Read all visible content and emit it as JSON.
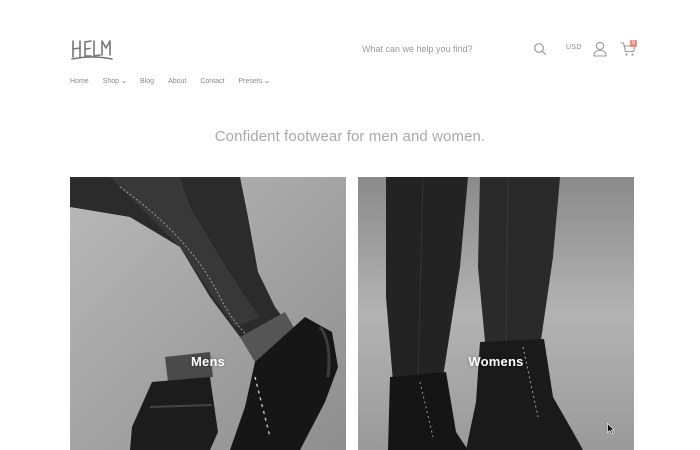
{
  "header": {
    "logo_text": "HELM",
    "search": {
      "placeholder": "What can we help you find?"
    },
    "currency": "USD",
    "cart_count": "0"
  },
  "nav": {
    "items": [
      {
        "label": "Home"
      },
      {
        "label": "Shop",
        "has_dropdown": true
      },
      {
        "label": "Blog"
      },
      {
        "label": "About"
      },
      {
        "label": "Contact"
      },
      {
        "label": "Presets",
        "has_dropdown": true
      }
    ]
  },
  "hero": {
    "tagline": "Confident footwear for men and women."
  },
  "collections": [
    {
      "label": "Mens"
    },
    {
      "label": "Womens"
    }
  ],
  "icons": {
    "search": "search-icon",
    "account": "user-icon",
    "cart": "cart-icon",
    "dropdown": "chevron-down-icon"
  },
  "colors": {
    "text_muted": "#8a8a8a",
    "tagline": "#a9a9a9",
    "badge": "#e98b7e"
  }
}
